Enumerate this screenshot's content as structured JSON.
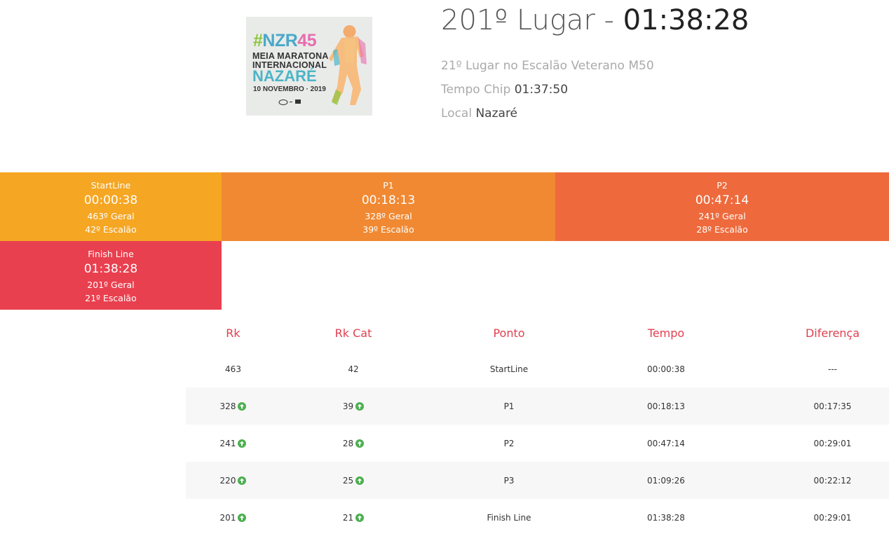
{
  "event": {
    "logo": {
      "hash": "#",
      "tag": "NZR",
      "num": "45",
      "line1": "MEIA MARATONA",
      "line2": "INTERNACIONAL",
      "line3": "NAZARÉ",
      "date": "10 NOVEMBRO · 2019"
    }
  },
  "result": {
    "position_text": "201º Lugar - ",
    "time": "01:38:28",
    "category_line": "21º Lugar no Escalão Veterano M50",
    "chip_label": "Tempo Chip",
    "chip_value": "01:37:50",
    "local_label": "Local",
    "local_value": "Nazaré"
  },
  "checkpoints": [
    {
      "name": "StartLine",
      "time": "00:00:38",
      "geral": "463º Geral",
      "escalao": "42º Escalão",
      "color": "#f5a623"
    },
    {
      "name": "P1",
      "time": "00:18:13",
      "geral": "328º Geral",
      "escalao": "39º Escalão",
      "color": "#f08932"
    },
    {
      "name": "P2",
      "time": "00:47:14",
      "geral": "241º Geral",
      "escalao": "28º Escalão",
      "color": "#ee6a3c"
    },
    {
      "name": "Finish Line",
      "time": "01:38:28",
      "geral": "201º Geral",
      "escalao": "21º Escalão",
      "color": "#e9404f"
    }
  ],
  "table": {
    "headers": [
      "Rk",
      "Rk Cat",
      "Ponto",
      "Tempo",
      "Diferença"
    ],
    "rows": [
      {
        "rk": "463",
        "rk_up": false,
        "rkcat": "42",
        "rkcat_up": false,
        "ponto": "StartLine",
        "tempo": "00:00:38",
        "diferenca": "---"
      },
      {
        "rk": "328",
        "rk_up": true,
        "rkcat": "39",
        "rkcat_up": true,
        "ponto": "P1",
        "tempo": "00:18:13",
        "diferenca": "00:17:35"
      },
      {
        "rk": "241",
        "rk_up": true,
        "rkcat": "28",
        "rkcat_up": true,
        "ponto": "P2",
        "tempo": "00:47:14",
        "diferenca": "00:29:01"
      },
      {
        "rk": "220",
        "rk_up": true,
        "rkcat": "25",
        "rkcat_up": true,
        "ponto": "P3",
        "tempo": "01:09:26",
        "diferenca": "00:22:12"
      },
      {
        "rk": "201",
        "rk_up": true,
        "rkcat": "21",
        "rkcat_up": true,
        "ponto": "Finish Line",
        "tempo": "01:38:28",
        "diferenca": "00:29:01"
      }
    ]
  },
  "icons": {
    "rank_up": "arrow-up-circle-icon",
    "rank_up_color": "#4caf50"
  },
  "colors": {
    "accent": "#e0404f"
  }
}
